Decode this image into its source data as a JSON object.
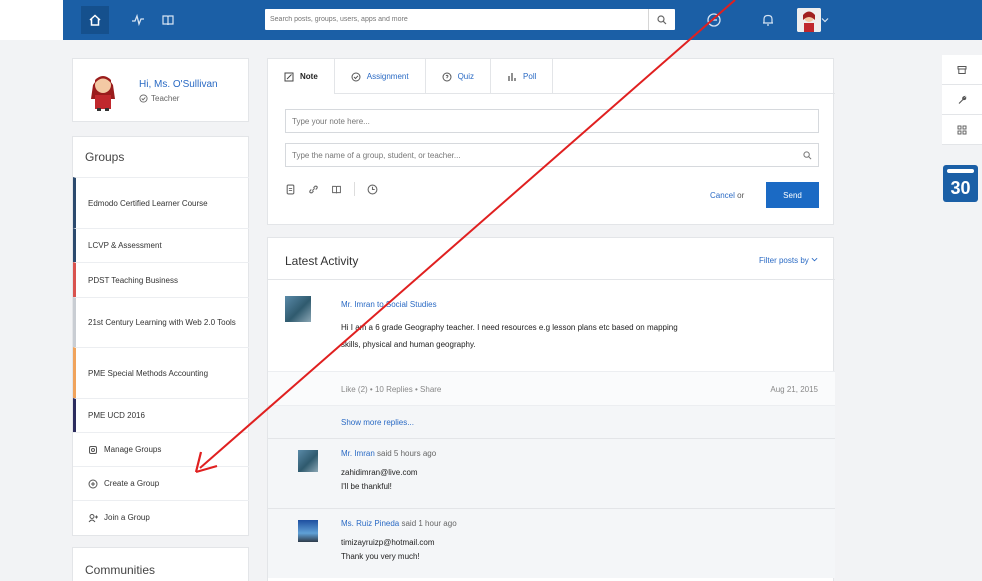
{
  "topbar": {
    "search_placeholder": "Search posts, groups, users, apps and more"
  },
  "profile": {
    "greeting": "Hi, Ms. O'Sullivan",
    "role": "Teacher"
  },
  "groups": {
    "title": "Groups",
    "items": [
      {
        "label": "Edmodo Certified Learner Course",
        "color": "#2c4a6e"
      },
      {
        "label": "LCVP & Assessment",
        "color": "#2c4a6e"
      },
      {
        "label": "PDST Teaching Business",
        "color": "#d9534f"
      },
      {
        "label": "21st Century Learning with Web 2.0 Tools",
        "color": "#c9cdd3"
      },
      {
        "label": "PME Special Methods Accounting",
        "color": "#f0a35c"
      },
      {
        "label": "PME UCD 2016",
        "color": "#2c2c5e"
      }
    ],
    "actions": [
      {
        "label": "Manage Groups",
        "icon": "gear-icon"
      },
      {
        "label": "Create a Group",
        "icon": "plus-circle-icon"
      },
      {
        "label": "Join a Group",
        "icon": "join-icon"
      }
    ]
  },
  "communities": {
    "title": "Communities"
  },
  "composer": {
    "tabs": [
      {
        "label": "Note",
        "icon": "note-icon"
      },
      {
        "label": "Assignment",
        "icon": "check-circle-icon"
      },
      {
        "label": "Quiz",
        "icon": "quiz-icon"
      },
      {
        "label": "Poll",
        "icon": "poll-icon"
      }
    ],
    "note_placeholder": "Type your note here...",
    "recipient_placeholder": "Type the name of a group, student, or teacher...",
    "cancel_label": "Cancel",
    "or_label": "or",
    "send_label": "Send"
  },
  "activity": {
    "title": "Latest Activity",
    "filter_label": "Filter posts by",
    "post": {
      "author": "Mr. Imran to Social Studies",
      "body_line1": "Hi I am a 6 grade Geography teacher. I need resources e.g lesson plans etc based on mapping",
      "body_line2": "skills, physical and human geography.",
      "like": "Like (2)",
      "replies": "10 Replies",
      "share": "Share",
      "date": "Aug 21, 2015"
    },
    "show_more": "Show more replies...",
    "replies": [
      {
        "name": "Mr. Imran",
        "when": "said 5 hours ago",
        "line1": "zahidimran@live.com",
        "line2": "I'll be thankful!"
      },
      {
        "name": "Ms. Ruiz Pineda",
        "when": "said 1 hour ago",
        "line1": "timizayruizp@hotmail.com",
        "line2": "Thank you very much!"
      }
    ]
  },
  "rail": {
    "calendar_day": "30"
  },
  "colors": {
    "brand_blue": "#1b5fa6",
    "annotation_red": "#e02020"
  }
}
